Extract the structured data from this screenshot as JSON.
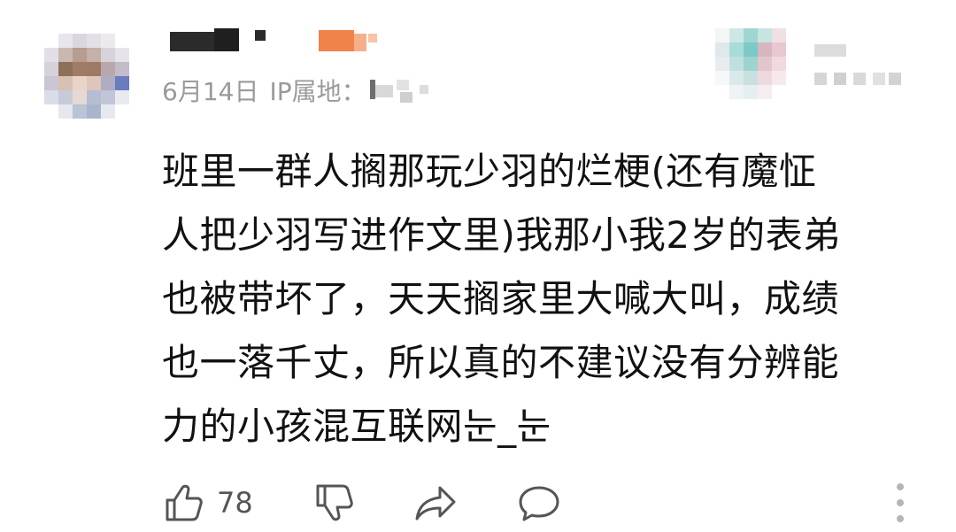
{
  "comment": {
    "date": "6月14日",
    "ip_label": "IP属地：",
    "body_lines": [
      "班里一群人搁那玩少羽的烂梗(还有魔怔",
      "人把少羽写进作文里)我那小我2岁的表弟",
      "也被带坏了，天天搁家里大喊大叫，成绩",
      "也一落千丈，所以真的不建议没有分辨能",
      "力的小孩混互联网눈_눈"
    ]
  },
  "actions": {
    "like_count": "78",
    "icons": [
      "thumbs-up-icon",
      "thumbs-down-icon",
      "share-icon",
      "comment-icon",
      "more-vertical-icon"
    ]
  },
  "colors": {
    "meta_text": "#9a9a9a",
    "body_text": "#111111",
    "icon_stroke": "#555555",
    "username_accent": "#f0834a"
  }
}
